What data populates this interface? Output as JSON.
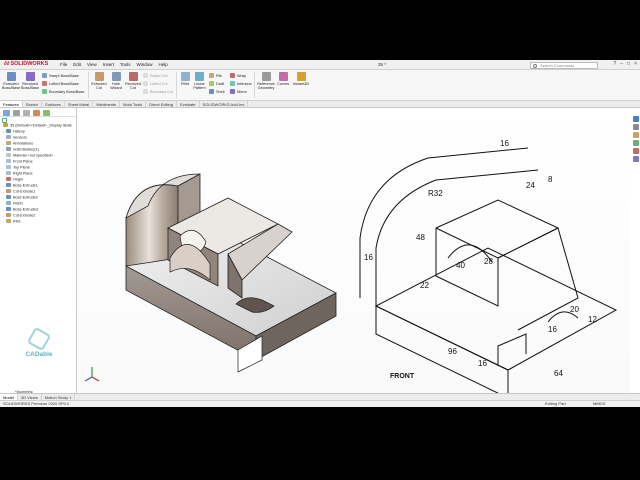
{
  "app": {
    "logo": "SOLIDWORKS",
    "menus": [
      "File",
      "Edit",
      "View",
      "Insert",
      "Tools",
      "Window",
      "Help"
    ],
    "doc_title": "35 *",
    "search_placeholder": "Search Commands",
    "window_buttons": [
      "?",
      "–",
      "□",
      "×"
    ]
  },
  "command_manager": {
    "large": [
      {
        "label": "Extruded Boss/Base",
        "dim": false,
        "color": "#6a8fc7"
      },
      {
        "label": "Revolved Boss/Base",
        "dim": false,
        "color": "#8a6ac7"
      },
      {
        "label": "Extruded Cut",
        "dim": false,
        "color": "#c79a6a"
      },
      {
        "label": "Hole Wizard",
        "dim": false,
        "color": "#7f9ab8"
      },
      {
        "label": "Revolved Cut",
        "dim": false,
        "color": "#b86a6a"
      },
      {
        "label": "Fillet",
        "dim": false,
        "color": "#8fb0d0"
      },
      {
        "label": "Linear Pattern",
        "dim": false,
        "color": "#6ab0c7"
      },
      {
        "label": "Reference Geometry",
        "dim": false,
        "color": "#9a9a9a"
      },
      {
        "label": "Curves",
        "dim": false,
        "color": "#c76aa8"
      },
      {
        "label": "Instant3D",
        "dim": false,
        "color": "#d4a32a"
      }
    ],
    "small_boss": [
      "Swept Boss/Base",
      "Lofted Boss/Base",
      "Boundary Boss/Base"
    ],
    "small_cut": [
      "Swept Cut",
      "Lofted Cut",
      "Boundary Cut"
    ],
    "small_features": [
      "Rib",
      "Draft",
      "Shell"
    ],
    "small_features2": [
      "Wrap",
      "Intersect",
      "Mirror"
    ]
  },
  "tabs": [
    "Features",
    "Sketch",
    "Surfaces",
    "Sheet Metal",
    "Weldments",
    "Mold Tools",
    "Direct Editing",
    "Evaluate",
    "SOLIDWORKS Add-Ins"
  ],
  "active_tab": "Features",
  "feature_tree": [
    {
      "label": "35 (Default<<Default>_Display State",
      "expand": ""
    },
    {
      "label": "History",
      "expand": "›"
    },
    {
      "label": "Sensors",
      "expand": ""
    },
    {
      "label": "Annotations",
      "expand": "›"
    },
    {
      "label": "Solid Bodies(1)",
      "expand": "›"
    },
    {
      "label": "Material <not specified>",
      "expand": ""
    },
    {
      "label": "Front Plane",
      "expand": ""
    },
    {
      "label": "Top Plane",
      "expand": ""
    },
    {
      "label": "Right Plane",
      "expand": ""
    },
    {
      "label": "Origin",
      "expand": ""
    },
    {
      "label": "Boss-Extrude1",
      "expand": "›"
    },
    {
      "label": "Cut-Extrude1",
      "expand": "›"
    },
    {
      "label": "Boss-Extrude2",
      "expand": "›"
    },
    {
      "label": "Fillet1",
      "expand": ""
    },
    {
      "label": "Boss-Extrude3",
      "expand": "›"
    },
    {
      "label": "Cut-Extrude2",
      "expand": "›"
    },
    {
      "label": "Rib1",
      "expand": "›"
    }
  ],
  "brand": "CADable",
  "view_label": "*Isometric",
  "drawing": {
    "dims": [
      "16",
      "R32",
      "24",
      "8",
      "48",
      "28",
      "40",
      "22",
      "16",
      "20",
      "12",
      "16",
      "96",
      "16",
      "64"
    ],
    "front_label": "FRONT"
  },
  "bottom_tabs": [
    "Model",
    "3D Views",
    "Motion Study 1"
  ],
  "status": {
    "left": "SOLIDWORKS Premium 2020 SP0.0",
    "mode": "Editing Part",
    "units": "MMGS"
  }
}
